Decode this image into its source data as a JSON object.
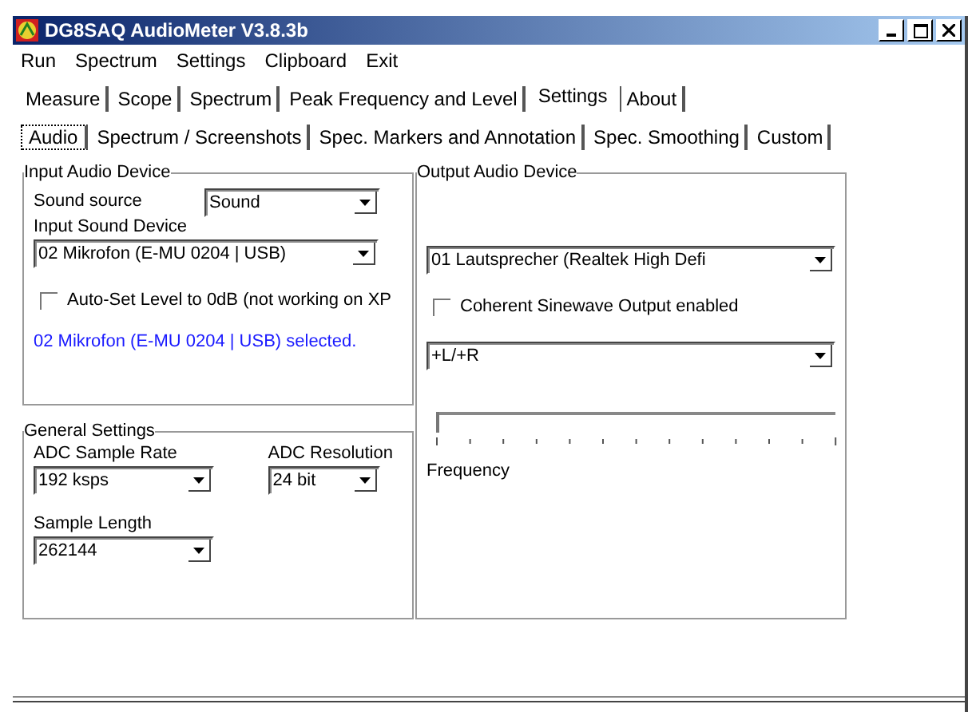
{
  "window": {
    "title": "DG8SAQ AudioMeter V3.8.3b"
  },
  "menu": [
    "Run",
    "Spectrum",
    "Settings",
    "Clipboard",
    "Exit"
  ],
  "tabs": [
    {
      "label": "Measure",
      "selected": false
    },
    {
      "label": "Scope",
      "selected": false
    },
    {
      "label": "Spectrum",
      "selected": false
    },
    {
      "label": "Peak Frequency and Level",
      "selected": false
    },
    {
      "label": "Settings",
      "selected": true
    },
    {
      "label": "About",
      "selected": false
    }
  ],
  "subtabs": [
    {
      "label": "Audio",
      "selected": true
    },
    {
      "label": "Spectrum / Screenshots",
      "selected": false
    },
    {
      "label": "Spec. Markers and Annotation",
      "selected": false
    },
    {
      "label": "Spec. Smoothing",
      "selected": false
    },
    {
      "label": "Custom",
      "selected": false
    }
  ],
  "input_group": {
    "title": "Input Audio Device",
    "sound_source": {
      "label": "Sound source",
      "value": "Sound"
    },
    "input_device": {
      "label": "Input Sound Device",
      "value": "02  Mikrofon (E-MU 0204 | USB)"
    },
    "auto_set": {
      "label": "Auto-Set Level to 0dB (not working on XP",
      "checked": false
    },
    "status": "02  Mikrofon (E-MU 0204 | USB) selected."
  },
  "general_group": {
    "title": "General Settings",
    "sample_rate": {
      "label": "ADC Sample Rate",
      "value": "192 ksps"
    },
    "resolution": {
      "label": "ADC Resolution",
      "value": "24 bit"
    },
    "sample_length": {
      "label": "Sample Length",
      "value": "262144"
    }
  },
  "output_group": {
    "title": "Output Audio Device",
    "output_device": {
      "value": "01  Lautsprecher (Realtek High Defi"
    },
    "coherent": {
      "label": "Coherent Sinewave Output enabled",
      "checked": false
    },
    "channels": {
      "value": "+L/+R"
    },
    "frequency": {
      "label": "Frequency",
      "level": 0
    }
  }
}
